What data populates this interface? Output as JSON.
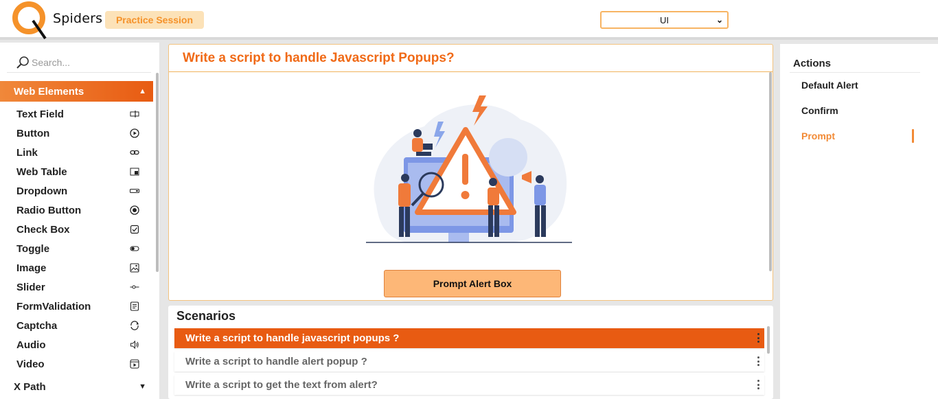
{
  "header": {
    "logo_text": "Spiders",
    "practice_label": "Practice Session",
    "select_value": "UI"
  },
  "sidebar": {
    "search_placeholder": "Search...",
    "section_label": "Web Elements",
    "items": [
      {
        "label": "Text Field",
        "icon": "text-field-icon"
      },
      {
        "label": "Button",
        "icon": "play-circle-icon"
      },
      {
        "label": "Link",
        "icon": "link-icon"
      },
      {
        "label": "Web Table",
        "icon": "table-icon"
      },
      {
        "label": "Dropdown",
        "icon": "dropdown-icon"
      },
      {
        "label": "Radio Button",
        "icon": "radio-icon"
      },
      {
        "label": "Check Box",
        "icon": "checkbox-icon"
      },
      {
        "label": "Toggle",
        "icon": "toggle-icon"
      },
      {
        "label": "Image",
        "icon": "image-icon"
      },
      {
        "label": "Slider",
        "icon": "slider-icon"
      },
      {
        "label": "FormValidation",
        "icon": "form-icon"
      },
      {
        "label": "Captcha",
        "icon": "captcha-icon"
      },
      {
        "label": "Audio",
        "icon": "speaker-icon"
      },
      {
        "label": "Video",
        "icon": "video-icon"
      }
    ],
    "xpath_label": "X Path"
  },
  "main": {
    "title": "Write a script to handle Javascript Popups?",
    "button_label": "Prompt Alert Box"
  },
  "scenarios": {
    "title": "Scenarios",
    "items": [
      "Write a script to handle javascript popups ?",
      "Write a script to handle alert popup ?",
      "Write a script to get the text from alert?"
    ],
    "active_index": 0
  },
  "actions": {
    "title": "Actions",
    "items": [
      "Default Alert",
      "Confirm",
      "Prompt"
    ],
    "active_index": 2
  },
  "colors": {
    "accent": "#e85b12",
    "accent_light": "#f28a35",
    "button": "#fdb777"
  }
}
